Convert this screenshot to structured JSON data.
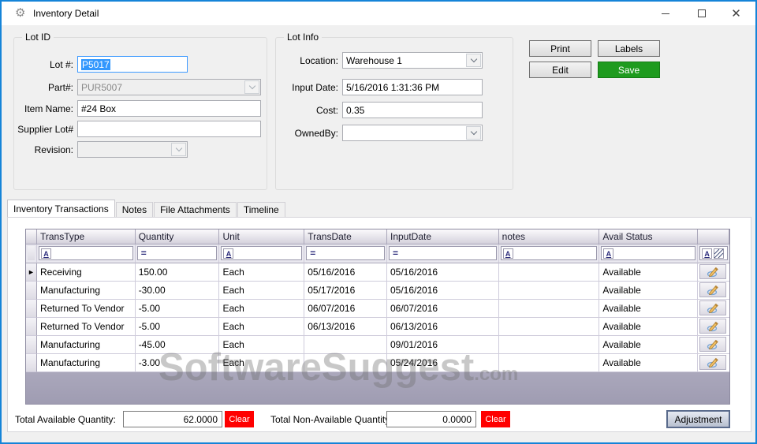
{
  "window": {
    "title": "Inventory Detail"
  },
  "lot_id": {
    "legend": "Lot ID",
    "lot_label": "Lot #:",
    "lot_value": "P5017",
    "part_label": "Part#:",
    "part_value": "PUR5007",
    "item_label": "Item Name:",
    "item_value": "#24 Box",
    "supplier_label": "Supplier Lot#",
    "supplier_value": "",
    "revision_label": "Revision:",
    "revision_value": ""
  },
  "lot_info": {
    "legend": "Lot Info",
    "location_label": "Location:",
    "location_value": "Warehouse 1",
    "input_date_label": "Input Date:",
    "input_date_value": "5/16/2016 1:31:36 PM",
    "cost_label": "Cost:",
    "cost_value": "0.35",
    "ownedby_label": "OwnedBy:",
    "ownedby_value": ""
  },
  "actions": {
    "print": "Print",
    "labels": "Labels",
    "edit": "Edit",
    "save": "Save"
  },
  "tabs": [
    {
      "label": "Inventory Transactions",
      "active": true
    },
    {
      "label": "Notes",
      "active": false
    },
    {
      "label": "File Attachments",
      "active": false
    },
    {
      "label": "Timeline",
      "active": false
    }
  ],
  "grid": {
    "columns": [
      {
        "label": "TransType",
        "filter": "text"
      },
      {
        "label": "Quantity",
        "filter": "eq"
      },
      {
        "label": "Unit",
        "filter": "text"
      },
      {
        "label": "TransDate",
        "filter": "eq"
      },
      {
        "label": "InputDate",
        "filter": "eq"
      },
      {
        "label": "notes",
        "filter": "text"
      },
      {
        "label": "Avail Status",
        "filter": "text"
      },
      {
        "label": "",
        "filter": "special"
      }
    ],
    "rows": [
      {
        "current": true,
        "trans_type": "Receiving",
        "quantity": "150.00",
        "unit": "Each",
        "trans_date": "05/16/2016",
        "input_date": "05/16/2016",
        "notes": "",
        "avail_status": "Available"
      },
      {
        "current": false,
        "trans_type": "Manufacturing",
        "quantity": "-30.00",
        "unit": "Each",
        "trans_date": "05/17/2016",
        "input_date": "05/16/2016",
        "notes": "",
        "avail_status": "Available"
      },
      {
        "current": false,
        "trans_type": "Returned To Vendor",
        "quantity": "-5.00",
        "unit": "Each",
        "trans_date": "06/07/2016",
        "input_date": "06/07/2016",
        "notes": "",
        "avail_status": "Available"
      },
      {
        "current": false,
        "trans_type": "Returned To Vendor",
        "quantity": "-5.00",
        "unit": "Each",
        "trans_date": "06/13/2016",
        "input_date": "06/13/2016",
        "notes": "",
        "avail_status": "Available"
      },
      {
        "current": false,
        "trans_type": "Manufacturing",
        "quantity": "-45.00",
        "unit": "Each",
        "trans_date": "",
        "input_date": "09/01/2016",
        "notes": "",
        "avail_status": "Available"
      },
      {
        "current": false,
        "trans_type": "Manufacturing",
        "quantity": "-3.00",
        "unit": "Each",
        "trans_date": "",
        "input_date": "05/24/2016",
        "notes": "",
        "avail_status": "Available"
      }
    ]
  },
  "watermark": {
    "text": "SoftwareSuggest",
    "suffix": ".com"
  },
  "totals": {
    "available_label": "Total Available Quantity:",
    "available_value": "62.0000",
    "clear_label": "Clear",
    "non_available_label": "Total Non-Available Quantity:",
    "non_available_value": "0.0000",
    "adjustment_label": "Adjustment"
  },
  "colors": {
    "accent_blue": "#1584d8",
    "save_green": "#1e9b1e",
    "clear_red": "#ff0000"
  }
}
